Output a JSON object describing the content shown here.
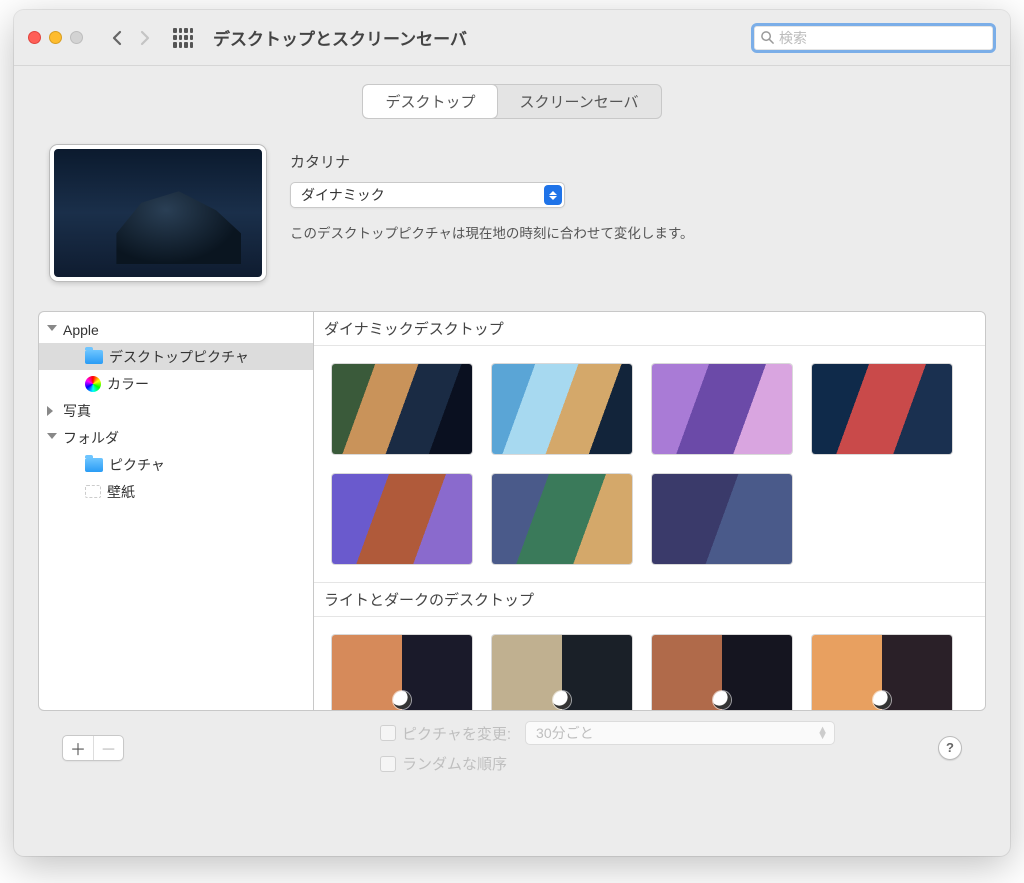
{
  "window": {
    "title": "デスクトップとスクリーンセーバ"
  },
  "search": {
    "placeholder": "検索"
  },
  "tabs": {
    "desktop": "デスクトップ",
    "screensaver": "スクリーンセーバ"
  },
  "wallpaper": {
    "name": "カタリナ",
    "mode": "ダイナミック",
    "desc": "このデスクトップピクチャは現在地の時刻に合わせて変化します。"
  },
  "sidebar": {
    "apple": "Apple",
    "desktop_pictures": "デスクトップピクチャ",
    "colors": "カラー",
    "photos": "写真",
    "folders": "フォルダ",
    "pictures": "ピクチャ",
    "wallpaper_folder": "壁紙"
  },
  "sections": {
    "dynamic": "ダイナミックデスクトップ",
    "lightdark": "ライトとダークのデスクトップ"
  },
  "footer": {
    "change_picture": "ピクチャを変更:",
    "interval": "30分ごと",
    "random": "ランダムな順序",
    "help": "?"
  }
}
